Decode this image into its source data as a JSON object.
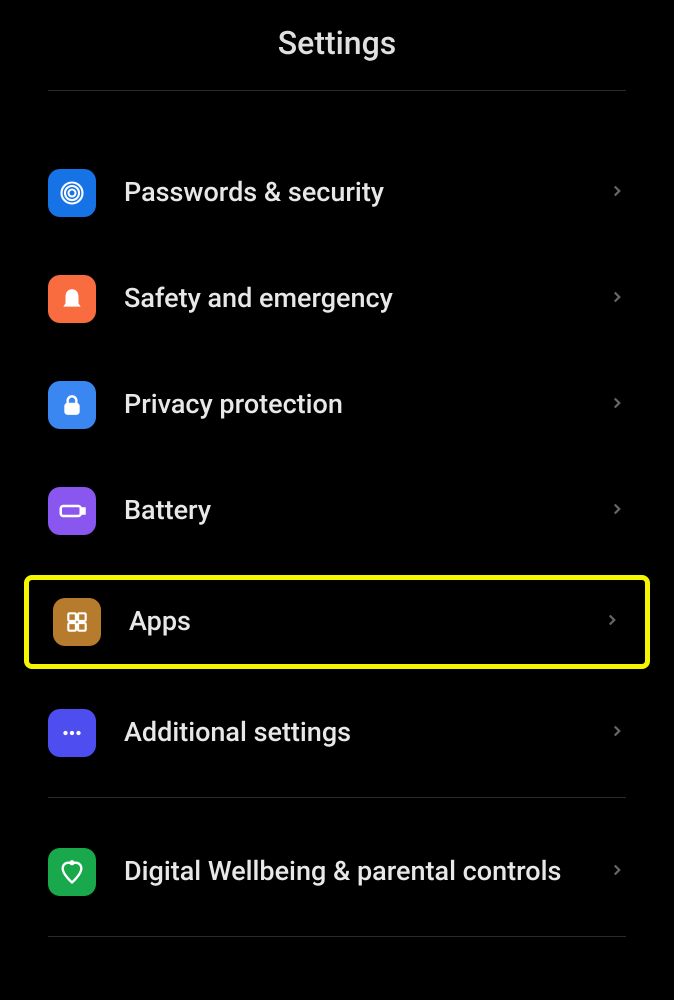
{
  "header": {
    "title": "Settings"
  },
  "items": [
    {
      "label": "Passwords & security",
      "icon_name": "fingerprint-icon",
      "icon_class": "icon-blue"
    },
    {
      "label": "Safety and emergency",
      "icon_name": "bell-icon",
      "icon_class": "icon-orange"
    },
    {
      "label": "Privacy protection",
      "icon_name": "lock-icon",
      "icon_class": "icon-lightblue"
    },
    {
      "label": "Battery",
      "icon_name": "battery-icon",
      "icon_class": "icon-purple"
    },
    {
      "label": "Apps",
      "icon_name": "apps-icon",
      "icon_class": "icon-brown",
      "highlighted": true
    },
    {
      "label": "Additional settings",
      "icon_name": "dots-icon",
      "icon_class": "icon-indigo"
    }
  ],
  "group2": [
    {
      "label": "Digital Wellbeing & parental controls",
      "icon_name": "heart-icon",
      "icon_class": "icon-green"
    }
  ]
}
